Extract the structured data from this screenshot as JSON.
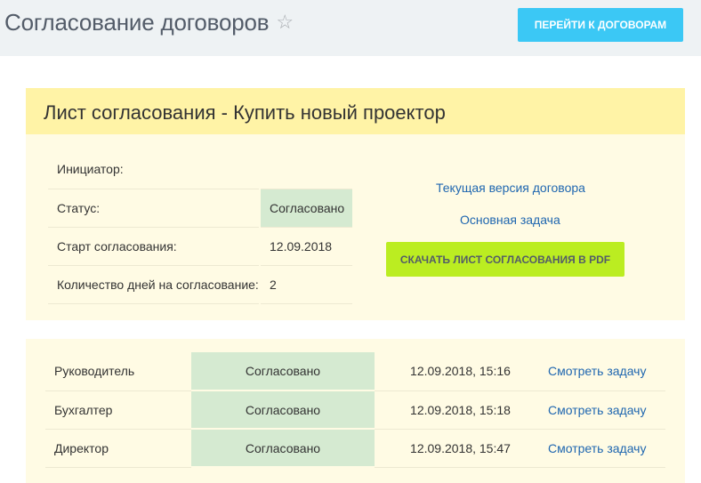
{
  "header": {
    "title": "Согласование договоров",
    "star_icon": "☆",
    "goto_button": "Перейти к договорам"
  },
  "sheet": {
    "title": "Лист согласования - Купить новый проектор",
    "info": [
      {
        "label": "Инициатор:",
        "value": ""
      },
      {
        "label": "Статус:",
        "value": "Согласовано"
      },
      {
        "label": "Старт согласования:",
        "value": "12.09.2018"
      },
      {
        "label": "Количество дней на согласование:",
        "value": "2"
      }
    ],
    "links": {
      "current_version": "Текущая версия договора",
      "main_task": "Основная задача"
    },
    "pdf_button": "Скачать лист согласования в PDF"
  },
  "approvals": [
    {
      "role": "Руководитель",
      "status": "Согласовано",
      "date": "12.09.2018, 15:16",
      "action": "Смотреть задачу"
    },
    {
      "role": "Бухгалтер",
      "status": "Согласовано",
      "date": "12.09.2018, 15:18",
      "action": "Смотреть задачу"
    },
    {
      "role": "Директор",
      "status": "Согласовано",
      "date": "12.09.2018, 15:47",
      "action": "Смотреть задачу"
    }
  ],
  "colors": {
    "header_bg": "#eef2f4",
    "accent_blue": "#3bc8f5",
    "accent_green": "#bbed21",
    "title_bar": "#fff3a6",
    "panel_bg": "#fffbe4",
    "status_bg": "#d5ead1",
    "link": "#2067b0"
  }
}
